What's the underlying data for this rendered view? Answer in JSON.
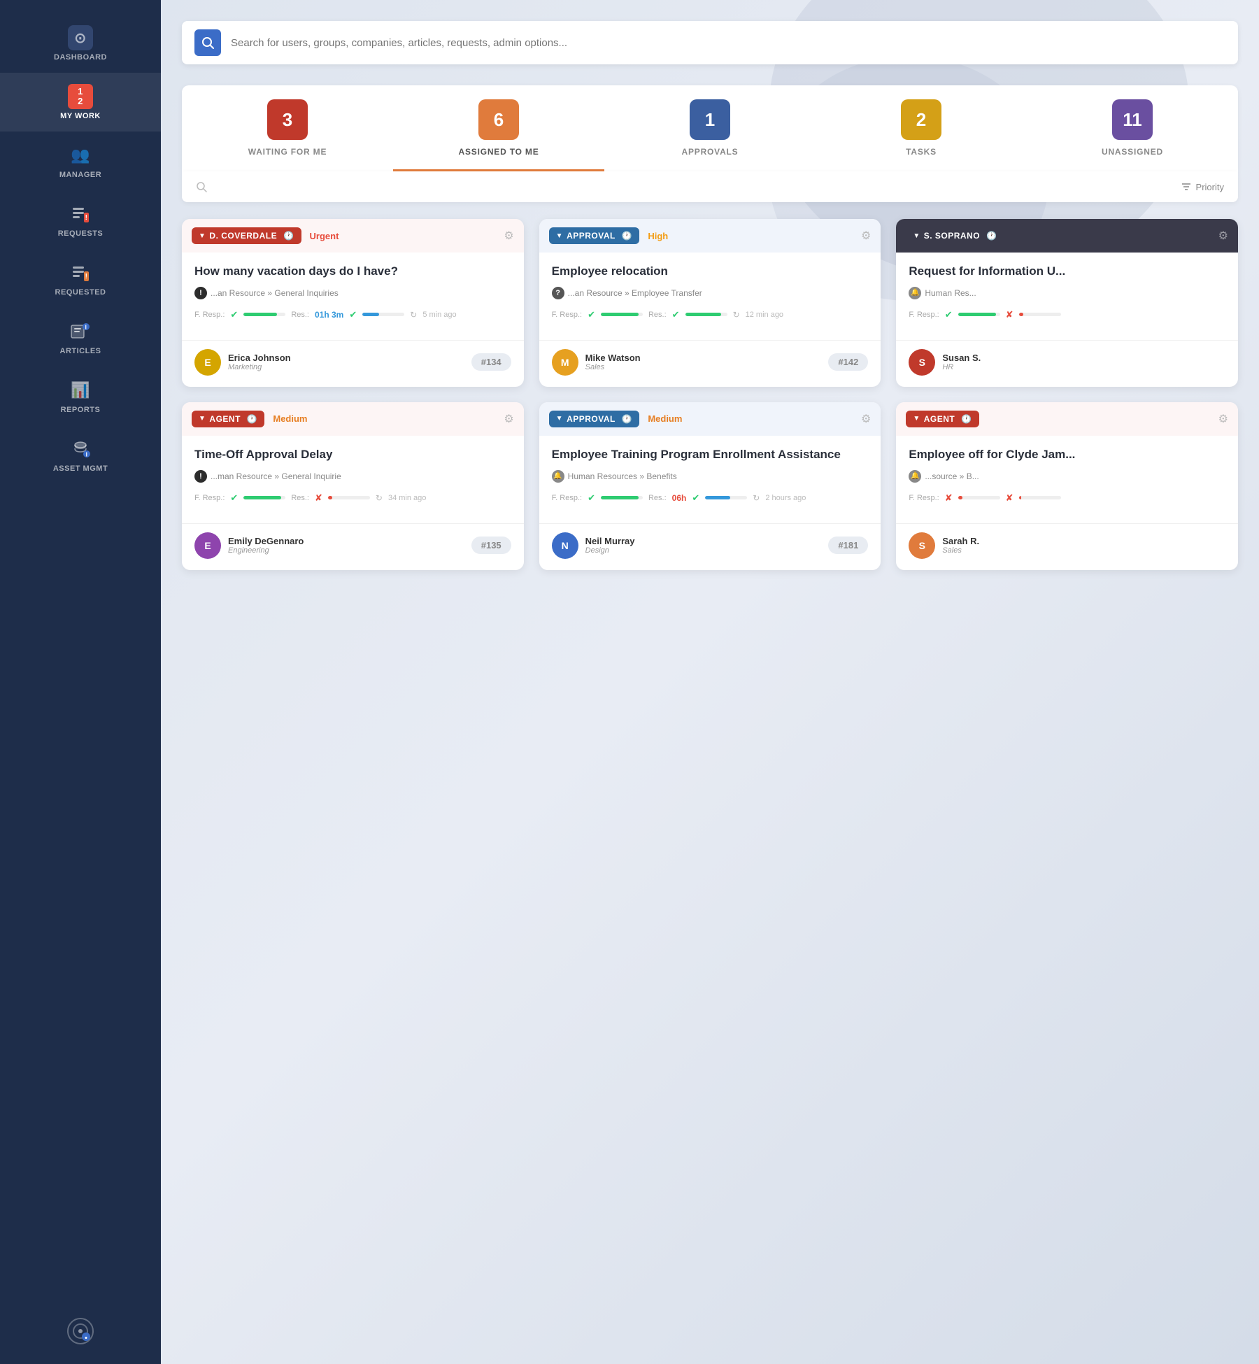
{
  "sidebar": {
    "items": [
      {
        "id": "dashboard",
        "label": "DASHBOARD",
        "icon": "⊙"
      },
      {
        "id": "mywork",
        "label": "MY WORK",
        "icon": "≡"
      },
      {
        "id": "manager",
        "label": "MANAGER",
        "icon": "👥"
      },
      {
        "id": "requests",
        "label": "REQUESTS",
        "icon": "☰!"
      },
      {
        "id": "requested",
        "label": "REQUESTED",
        "icon": "☰!"
      },
      {
        "id": "articles",
        "label": "ARTICLES",
        "icon": "🗂"
      },
      {
        "id": "reports",
        "label": "REPORTS",
        "icon": "📊"
      },
      {
        "id": "assetmgmt",
        "label": "ASSET MGMT",
        "icon": "⚙"
      }
    ],
    "logo": "◎"
  },
  "search": {
    "placeholder": "Search for users, groups, companies, articles, requests, admin options..."
  },
  "tabs": [
    {
      "id": "waiting",
      "count": "3",
      "label": "WAITING FOR ME",
      "color": "#c0392b"
    },
    {
      "id": "assigned",
      "count": "6",
      "label": "ASSIGNED TO ME",
      "color": "#e07b3c",
      "active": true
    },
    {
      "id": "approvals",
      "count": "1",
      "label": "APPROVALS",
      "color": "#3b5fa0"
    },
    {
      "id": "tasks",
      "count": "2",
      "label": "TASKS",
      "color": "#d4a017"
    },
    {
      "id": "unassigned",
      "count": "11",
      "label": "UNASSIGNED",
      "color": "#6a4fa0"
    }
  ],
  "filter": {
    "search_placeholder": "🔍",
    "priority_label": "Priority"
  },
  "cards": [
    {
      "id": "card1",
      "header_tag": "D. COVERDALE",
      "header_tag_color": "tag-red",
      "has_clock": true,
      "priority": "Urgent",
      "priority_class": "priority-urgent",
      "settings": true,
      "title": "How many vacation days do I have?",
      "path_icon": "path-icon-exclaim",
      "path": "...an Resource » General Inquiries",
      "f_resp_label": "F. Resp.:",
      "f_resp_status": "check",
      "res_label": "Res.:",
      "res_time": "01h 3m",
      "res_time_class": "meta-time",
      "res_status": "check",
      "progress1": 80,
      "progress1_color": "fill-green",
      "progress2": 40,
      "progress2_color": "fill-blue",
      "time_ago": "5 min ago",
      "agent_name": "Erica Johnson",
      "agent_dept": "Marketing",
      "ticket": "#134",
      "avatar_color": "#d4a500",
      "avatar_letter": "E"
    },
    {
      "id": "card2",
      "header_tag": "APPROVAL",
      "header_tag_color": "tag-blue",
      "has_clock": true,
      "priority": "High",
      "priority_class": "priority-high",
      "settings": true,
      "title": "Employee relocation",
      "path_icon": "path-icon-question",
      "path": "...an Resource » Employee Transfer",
      "f_resp_label": "F. Resp.:",
      "f_resp_status": "check",
      "res_label": "Res.:",
      "res_time": "",
      "res_time_class": "",
      "res_status": "check",
      "progress1": 90,
      "progress1_color": "fill-green",
      "progress2": 85,
      "progress2_color": "fill-green",
      "time_ago": "12 min ago",
      "agent_name": "Mike Watson",
      "agent_dept": "Sales",
      "ticket": "#142",
      "avatar_color": "#e6a020",
      "avatar_letter": "M"
    },
    {
      "id": "card3",
      "header_tag": "S. SOPRANO",
      "header_tag_color": "tag-dark",
      "has_clock": true,
      "priority": "",
      "priority_class": "",
      "settings": true,
      "title": "Request for Information U...",
      "path_icon": "path-icon-bell",
      "path": "Human Res...",
      "f_resp_label": "F. Resp.:",
      "f_resp_status": "check",
      "res_label": "",
      "res_time": "",
      "res_time_class": "",
      "res_status": "cross",
      "progress1": 90,
      "progress1_color": "fill-green",
      "progress2": 0,
      "progress2_color": "fill-red",
      "time_ago": "",
      "agent_name": "Susan S.",
      "agent_dept": "HR",
      "ticket": "",
      "avatar_color": "#c0392b",
      "avatar_letter": "S"
    },
    {
      "id": "card4",
      "header_tag": "AGENT",
      "header_tag_color": "tag-red",
      "has_clock": true,
      "priority": "Medium",
      "priority_class": "priority-medium",
      "settings": true,
      "title": "Time-Off Approval Delay",
      "path_icon": "path-icon-exclaim",
      "path": "...man Resource » General Inquirie",
      "f_resp_label": "F. Resp.:",
      "f_resp_status": "check",
      "res_label": "Res.:",
      "res_time": "",
      "res_time_class": "",
      "res_status": "cross",
      "progress1": 90,
      "progress1_color": "fill-green",
      "progress2": 10,
      "progress2_color": "fill-red",
      "time_ago": "34 min ago",
      "agent_name": "Emily DeGennaro",
      "agent_dept": "Engineering",
      "ticket": "#135",
      "avatar_color": "#8e44ad",
      "avatar_letter": "E"
    },
    {
      "id": "card5",
      "header_tag": "APPROVAL",
      "header_tag_color": "tag-blue",
      "has_clock": true,
      "priority": "Medium",
      "priority_class": "priority-medium",
      "settings": true,
      "title": "Employee Training Program Enrollment Assistance",
      "path_icon": "path-icon-bell",
      "path": "Human Resources » Benefits",
      "f_resp_label": "F. Resp.:",
      "f_resp_status": "check",
      "res_label": "Res.:",
      "res_time": "06h",
      "res_time_class": "meta-time-red",
      "res_status": "check",
      "progress1": 90,
      "progress1_color": "fill-green",
      "progress2": 60,
      "progress2_color": "fill-blue",
      "time_ago": "2 hours ago",
      "agent_name": "Neil Murray",
      "agent_dept": "Design",
      "ticket": "#181",
      "avatar_color": "#3b6cc7",
      "avatar_letter": "N"
    },
    {
      "id": "card6",
      "header_tag": "AGENT",
      "header_tag_color": "tag-red",
      "has_clock": true,
      "priority": "",
      "priority_class": "",
      "settings": true,
      "title": "Employee off for Clyde Jam...",
      "path_icon": "path-icon-bell",
      "path": "...source » B...",
      "f_resp_label": "F. Resp.:",
      "f_resp_status": "cross",
      "res_label": "",
      "res_time": "",
      "res_time_class": "",
      "res_status": "cross",
      "progress1": 10,
      "progress1_color": "fill-red",
      "progress2": 0,
      "progress2_color": "fill-red",
      "time_ago": "",
      "agent_name": "Sarah R.",
      "agent_dept": "Sales",
      "ticket": "",
      "avatar_color": "#e07b3c",
      "avatar_letter": "S"
    }
  ]
}
